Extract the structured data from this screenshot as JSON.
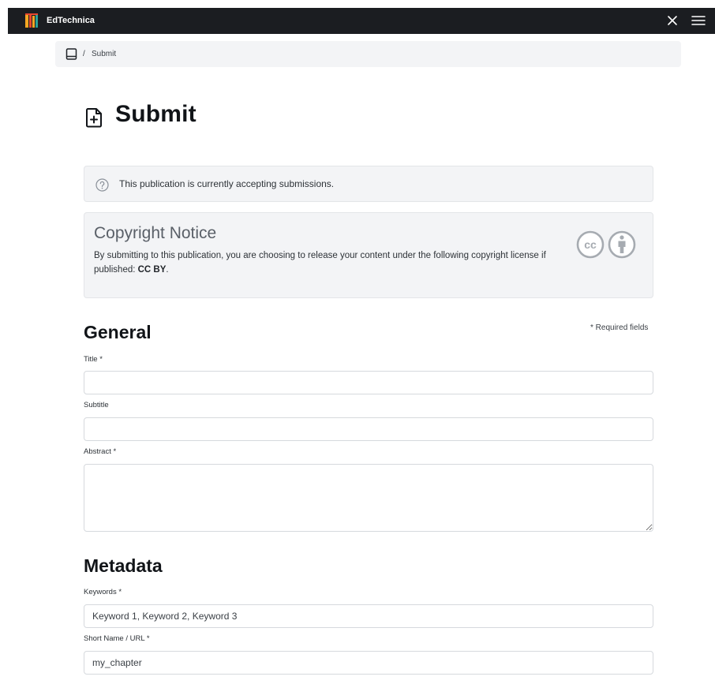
{
  "app": {
    "brand": "EdTechnica"
  },
  "breadcrumb": {
    "separator": "/",
    "current": "Submit"
  },
  "page": {
    "title": "Submit"
  },
  "alert": {
    "message": "This publication is currently accepting submissions."
  },
  "copyright": {
    "heading": "Copyright Notice",
    "text": "By submitting to this publication, you are choosing to release your content under the following copyright license if published: ",
    "license": "CC BY",
    "end": "."
  },
  "general": {
    "heading": "General",
    "required_note": "* Required fields",
    "title_label": "Title *",
    "subtitle_label": "Subtitle",
    "abstract_label": "Abstract *"
  },
  "metadata": {
    "heading": "Metadata",
    "keywords_label": "Keywords *",
    "keywords_placeholder": "Keyword 1, Keyword 2, Keyword 3",
    "shortname_label": "Short Name / URL *",
    "shortname_placeholder": "my_chapter"
  },
  "colors": {
    "topbar": "#1b1d21",
    "panel": "#f3f4f6",
    "logo_orange": "#f5a623",
    "logo_red": "#e8472e",
    "logo_teal": "#2aa198"
  },
  "icons": [
    "logo-icon",
    "close-icon",
    "hamburger-menu-icon",
    "book-icon",
    "file-plus-icon",
    "question-circle-icon",
    "cc-by-icon"
  ]
}
